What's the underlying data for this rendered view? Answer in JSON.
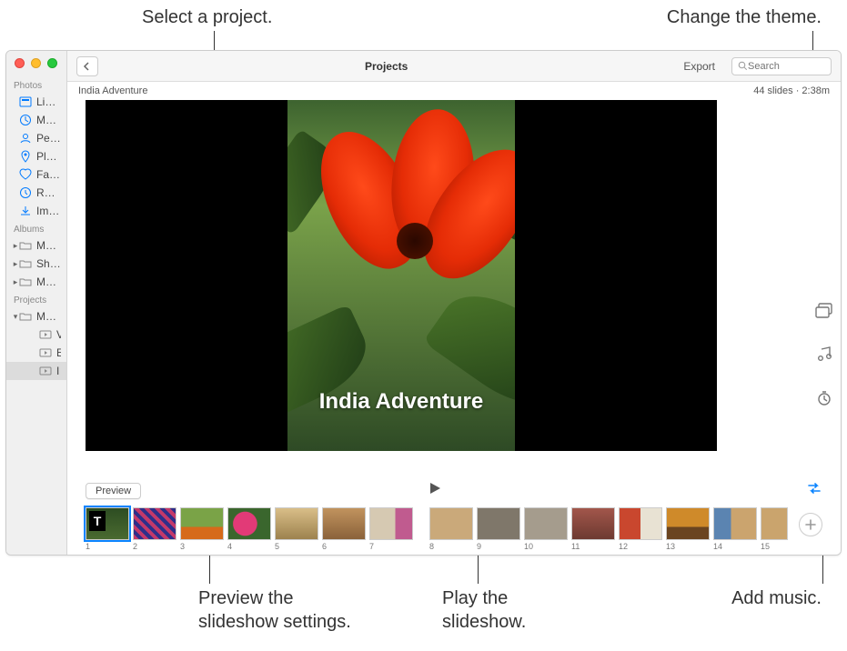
{
  "callouts": {
    "select_project": "Select a project.",
    "change_theme": "Change the theme.",
    "preview_settings_l1": "Preview the",
    "preview_settings_l2": "slideshow settings.",
    "play_l1": "Play the",
    "play_l2": "slideshow.",
    "add_music": "Add music."
  },
  "toolbar": {
    "title": "Projects",
    "export": "Export",
    "search_placeholder": "Search"
  },
  "sidebar": {
    "sections": {
      "photos": "Photos",
      "albums": "Albums",
      "projects": "Projects"
    },
    "photos": {
      "library": "Library",
      "memories": "Memories",
      "people": "People",
      "places": "Places",
      "favourites": "Favourites",
      "recents": "Recents",
      "imports": "Imports"
    },
    "albums": {
      "media_types": "Media Types",
      "shared": "Shared Albums",
      "my_albums": "My Albums"
    },
    "projects": {
      "my_projects": "My Projects",
      "items": [
        "Visit to Lisbon",
        "Exploring Mor…",
        "India Adventure"
      ]
    }
  },
  "project": {
    "title": "India Adventure",
    "meta": "44 slides · 2:38m",
    "stage_title": "India Adventure"
  },
  "transport": {
    "preview": "Preview"
  },
  "thumbs": [
    {
      "n": "1"
    },
    {
      "n": "2"
    },
    {
      "n": "3"
    },
    {
      "n": "4"
    },
    {
      "n": "5"
    },
    {
      "n": "6"
    },
    {
      "n": "7"
    },
    {
      "n": "8"
    },
    {
      "n": "9"
    },
    {
      "n": "10"
    },
    {
      "n": "11"
    },
    {
      "n": "12"
    },
    {
      "n": "13"
    },
    {
      "n": "14"
    },
    {
      "n": "15"
    }
  ]
}
